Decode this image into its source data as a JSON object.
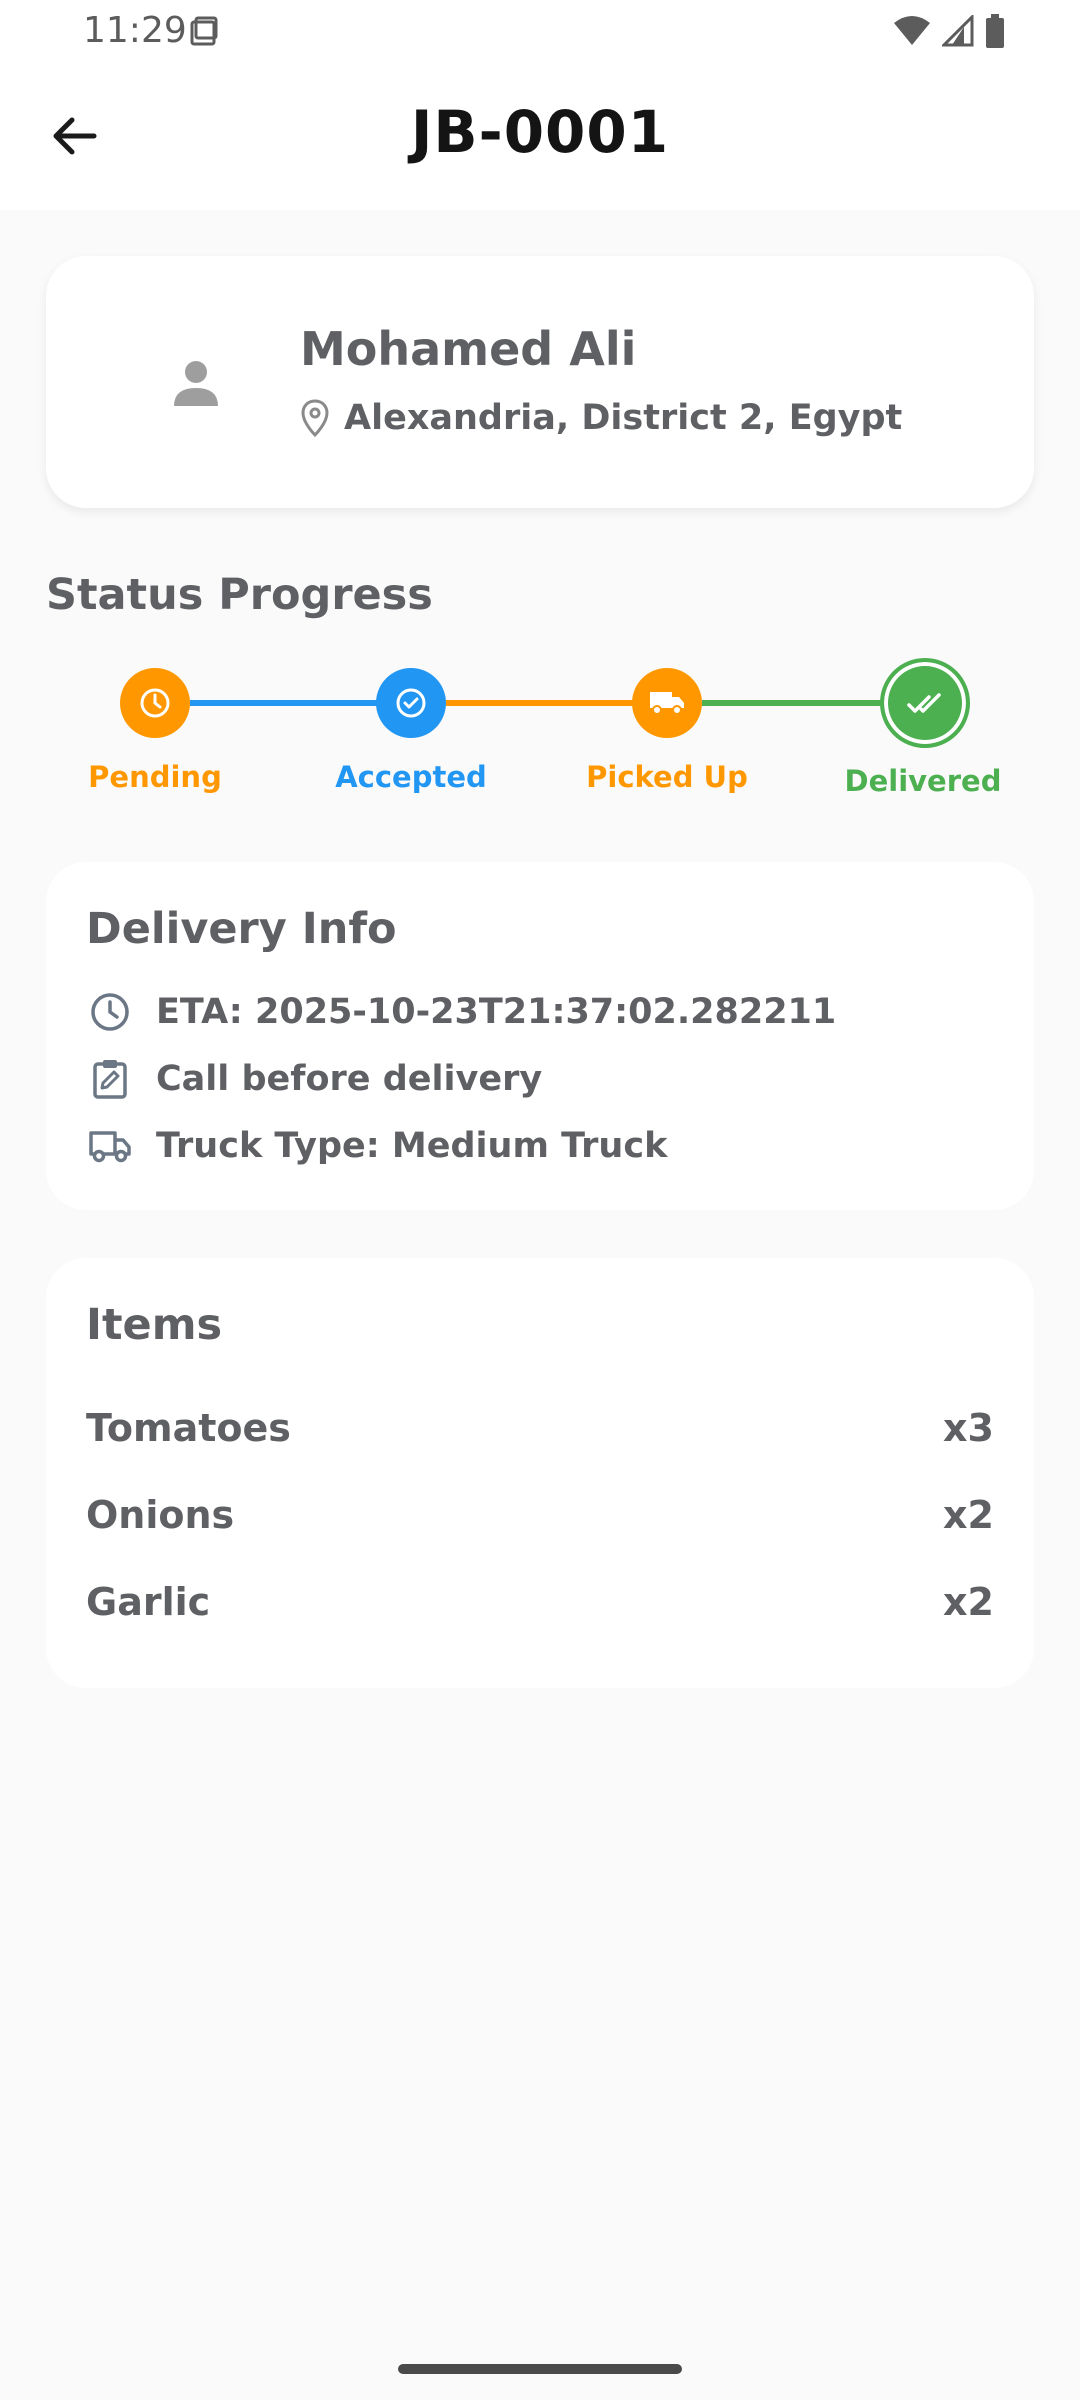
{
  "status_bar": {
    "time": "11:29"
  },
  "app_bar": {
    "title": "JB-0001"
  },
  "customer": {
    "name": "Mohamed Ali",
    "location": "Alexandria, District 2, Egypt"
  },
  "status_progress": {
    "title": "Status Progress",
    "steps": [
      {
        "label": "Pending",
        "color": "#ff9800",
        "icon": "clock-icon"
      },
      {
        "label": "Accepted",
        "color": "#2196f3",
        "icon": "check-circle-icon"
      },
      {
        "label": "Picked Up",
        "color": "#ff9800",
        "icon": "truck-icon"
      },
      {
        "label": "Delivered",
        "color": "#4caf50",
        "icon": "double-check-icon"
      }
    ]
  },
  "delivery_info": {
    "title": "Delivery Info",
    "eta": "ETA: 2025-10-23T21:37:02.282211",
    "note": "Call before delivery",
    "truck_type": "Truck Type: Medium Truck"
  },
  "items": {
    "title": "Items",
    "list": [
      {
        "name": "Tomatoes",
        "qty": "x3"
      },
      {
        "name": "Onions",
        "qty": "x2"
      },
      {
        "name": "Garlic",
        "qty": "x2"
      }
    ]
  }
}
